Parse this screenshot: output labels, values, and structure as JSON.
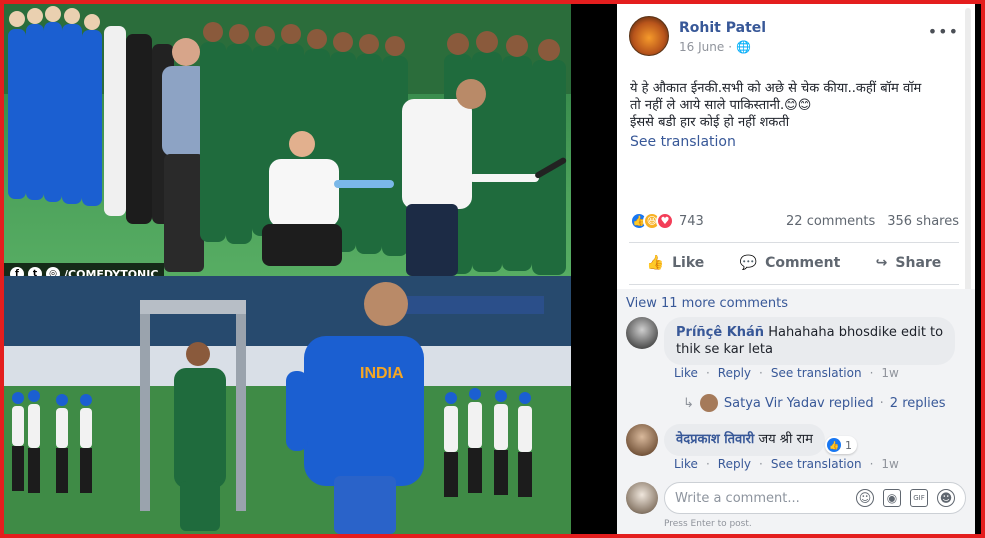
{
  "post": {
    "author": "Rohit Patel",
    "date": "16 June",
    "more_icon": "•••",
    "text_line1": "ये हे औकात ईनकी.सभी को अछे से चेक कीया..कहीं बॉम वॉम",
    "text_line2": "तो नहीं ले आये साले पाकिस्तानी.😊😊",
    "text_line3": "ईससे बडी हार कोई हो नहीं शकती",
    "see_translation": "See translation",
    "reaction_count": "743",
    "comments_count": "22 comments",
    "shares_count": "356 shares"
  },
  "actions": {
    "like": "Like",
    "comment": "Comment",
    "share": "Share"
  },
  "image": {
    "social_handle": "/COMEDYTONIC"
  },
  "comments": {
    "view_more": "View 11 more comments",
    "items": [
      {
        "name": "Príñçê Kháñ",
        "text": "Hahahaha bhosdike edit to",
        "text2": "thik se kar leta",
        "like": "Like",
        "reply": "Reply",
        "see_translation": "See translation",
        "time": "1w"
      },
      {
        "name": "वेदप्रकाश तिवारी",
        "text": "जय श्री राम",
        "like_count": "1",
        "like": "Like",
        "reply": "Reply",
        "see_translation": "See translation",
        "time": "1w"
      }
    ],
    "reply_thread": {
      "text": "Satya Vir Yadav replied",
      "dot": "·",
      "replies": "2 replies"
    },
    "composer": {
      "placeholder": "Write a comment...",
      "hint": "Press Enter to post."
    }
  },
  "colors": {
    "brand_link": "#385898",
    "frame_red": "#e41e1e",
    "india_blue": "#1b5fd1",
    "pakistan_green": "#1f6b3d"
  }
}
